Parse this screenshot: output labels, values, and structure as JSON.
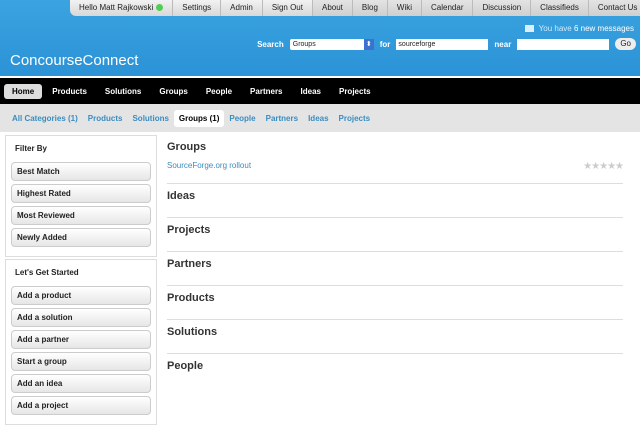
{
  "topbar": {
    "greeting": "Hello Matt Rajkowski",
    "items": [
      "Settings",
      "Admin",
      "Sign Out",
      "About",
      "Blog",
      "Wiki",
      "Calendar",
      "Discussion",
      "Classifieds",
      "Contact Us"
    ]
  },
  "messages": {
    "prefix": "You have",
    "count_text": "6 new messages"
  },
  "search": {
    "label": "Search",
    "category": "Groups",
    "for_label": "for",
    "query": "sourceforge",
    "near_label": "near",
    "near_value": "",
    "go": "Go"
  },
  "logo": "ConcourseConnect",
  "nav": [
    "Home",
    "Products",
    "Solutions",
    "Groups",
    "People",
    "Partners",
    "Ideas",
    "Projects"
  ],
  "subnav": [
    "All Categories (1)",
    "Products",
    "Solutions",
    "Groups (1)",
    "People",
    "Partners",
    "Ideas",
    "Projects"
  ],
  "filter": {
    "title": "Filter By",
    "items": [
      "Best Match",
      "Highest Rated",
      "Most Reviewed",
      "Newly Added"
    ]
  },
  "started": {
    "title": "Let's Get Started",
    "items": [
      "Add a product",
      "Add a solution",
      "Add a partner",
      "Start a group",
      "Add an idea",
      "Add a project"
    ]
  },
  "sections": [
    {
      "title": "Groups",
      "result": "SourceForge.org rollout",
      "rating": 0
    },
    {
      "title": "Ideas"
    },
    {
      "title": "Projects"
    },
    {
      "title": "Partners"
    },
    {
      "title": "Products"
    },
    {
      "title": "Solutions"
    },
    {
      "title": "People"
    }
  ]
}
